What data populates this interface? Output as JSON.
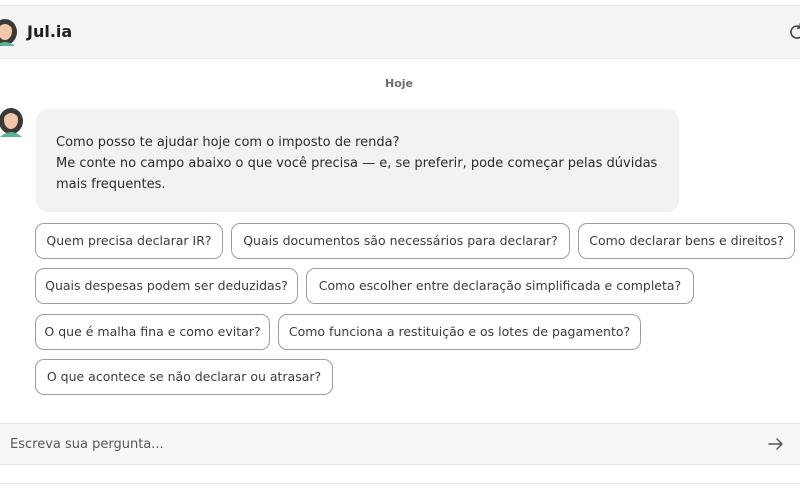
{
  "header": {
    "title": "Jul.ia",
    "avatar_icon": "woman-avatar-icon",
    "action_icon": "refresh-icon"
  },
  "chat": {
    "date_label": "Hoje",
    "message": {
      "lines": [
        "Como posso te ajudar hoje com o imposto de renda?",
        "Me conte no campo abaixo o que você precisa — e, se preferir, pode começar pelas dúvidas",
        "mais frequentes."
      ]
    },
    "suggestions": [
      "Quem precisa declarar IR?",
      "Quais documentos são necessários para declarar?",
      "Como declarar bens e direitos?",
      "Quais despesas podem ser deduzidas?",
      "Como escolher entre declaração simplificada e completa?",
      "O que é malha fina e como evitar?",
      "Como funciona a restituição e os lotes de pagamento?",
      "O que acontece se não declarar ou atrasar?"
    ]
  },
  "composer": {
    "placeholder": "Escreva sua pergunta...",
    "send_icon": "arrow-right-icon"
  },
  "colors": {
    "header_bg": "#f3f4f6",
    "bubble_bg": "#f1f2f4",
    "chip_border": "#9a9da2",
    "text": "#2b2b2b"
  }
}
